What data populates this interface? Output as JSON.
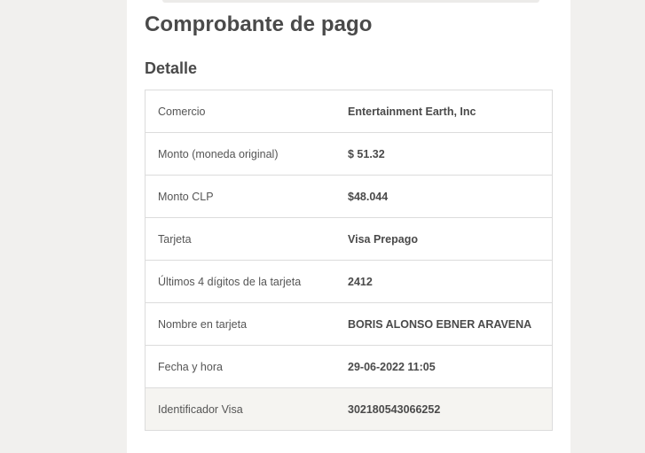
{
  "page": {
    "title": "Comprobante de pago",
    "section_title": "Detalle"
  },
  "details": [
    {
      "label": "Comercio",
      "value": "Entertainment Earth, Inc"
    },
    {
      "label": "Monto (moneda original)",
      "value": "$ 51.32"
    },
    {
      "label": "Monto CLP",
      "value": "$48.044"
    },
    {
      "label": "Tarjeta",
      "value": "Visa Prepago"
    },
    {
      "label": "Últimos 4 dígitos de la tarjeta",
      "value": "2412"
    },
    {
      "label": "Nombre en tarjeta",
      "value": "BORIS ALONSO EBNER ARAVENA"
    },
    {
      "label": "Fecha y hora",
      "value": "29-06-2022 11:05"
    },
    {
      "label": "Identificador Visa",
      "value": "302180543066252"
    }
  ],
  "colors": {
    "background": "#f1f0ee",
    "card": "#ffffff",
    "text": "#4a4a4a",
    "border": "#dcdcdc",
    "shaded_row": "#f5f4f1"
  }
}
